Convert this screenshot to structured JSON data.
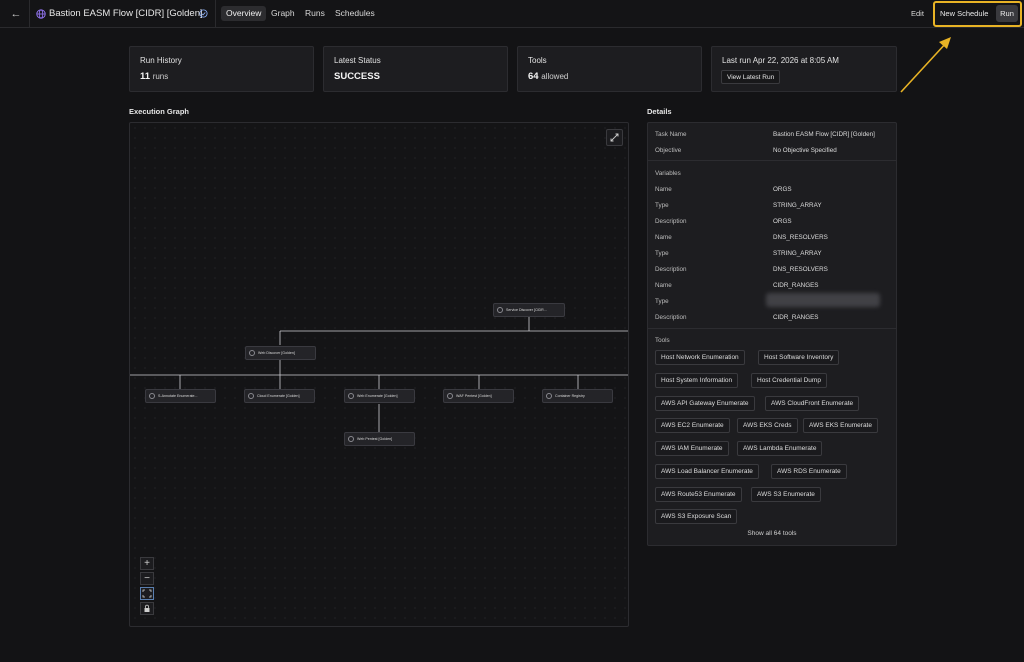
{
  "header": {
    "title": "Bastion EASM Flow [CIDR] [Golden]",
    "tabs": [
      "Overview",
      "Graph",
      "Runs",
      "Schedules"
    ],
    "active_tab": "Overview",
    "edit_label": "Edit",
    "new_schedule_label": "New Schedule",
    "run_label": "Run",
    "highlight_color": "#e8b325"
  },
  "stats": {
    "run_history": {
      "label": "Run History",
      "value": "11",
      "unit": "runs"
    },
    "latest_status": {
      "label": "Latest Status",
      "value": "SUCCESS"
    },
    "tools": {
      "label": "Tools",
      "value": "64",
      "unit": "allowed"
    },
    "last_run": {
      "label": "Last run Apr 22, 2026 at 8:05 AM",
      "button": "View Latest Run"
    }
  },
  "graph": {
    "title": "Execution Graph",
    "nodes": [
      {
        "id": "root",
        "label": "Service Discover [CIDR..."
      },
      {
        "id": "web",
        "label": "Web Discover [Golden]"
      },
      {
        "id": "n1",
        "label": "S-Annotate Enumerate..."
      },
      {
        "id": "n2",
        "label": "Cloud Enumerate [Golden]"
      },
      {
        "id": "n3",
        "label": "Web Enumerate [Golden]"
      },
      {
        "id": "n4",
        "label": "WAF Pentest [Golden]"
      },
      {
        "id": "n5",
        "label": "Container Registry"
      },
      {
        "id": "n6",
        "label": "Web Pentest [Golden]"
      }
    ],
    "controls": [
      "+",
      "−"
    ]
  },
  "details": {
    "title": "Details",
    "task_name_label": "Task Name",
    "task_name": "Bastion EASM Flow [CIDR] [Golden]",
    "objective_label": "Objective",
    "objective": "No Objective Specified",
    "variables_label": "Variables",
    "variables": [
      {
        "k": "Name",
        "v": "ORGS"
      },
      {
        "k": "Type",
        "v": "STRING_ARRAY"
      },
      {
        "k": "Description",
        "v": "ORGS"
      },
      {
        "k": "Name",
        "v": "DNS_RESOLVERS"
      },
      {
        "k": "Type",
        "v": "STRING_ARRAY"
      },
      {
        "k": "Description",
        "v": "DNS_RESOLVERS"
      },
      {
        "k": "Name",
        "v": "CIDR_RANGES"
      },
      {
        "k": "Type",
        "v": ""
      },
      {
        "k": "Description",
        "v": "CIDR_RANGES"
      }
    ],
    "tools_label": "Tools",
    "tools": [
      "Host Network Enumeration",
      "Host Software Inventory",
      "Host System Information",
      "Host Credential Dump",
      "AWS API Gateway Enumerate",
      "AWS CloudFront Enumerate",
      "AWS EC2 Enumerate",
      "AWS EKS Creds",
      "AWS EKS Enumerate",
      "AWS IAM Enumerate",
      "AWS Lambda Enumerate",
      "AWS Load Balancer Enumerate",
      "AWS RDS Enumerate",
      "AWS Route53 Enumerate",
      "AWS S3 Enumerate",
      "AWS S3 Exposure Scan"
    ],
    "show_all": "Show all 64 tools"
  }
}
